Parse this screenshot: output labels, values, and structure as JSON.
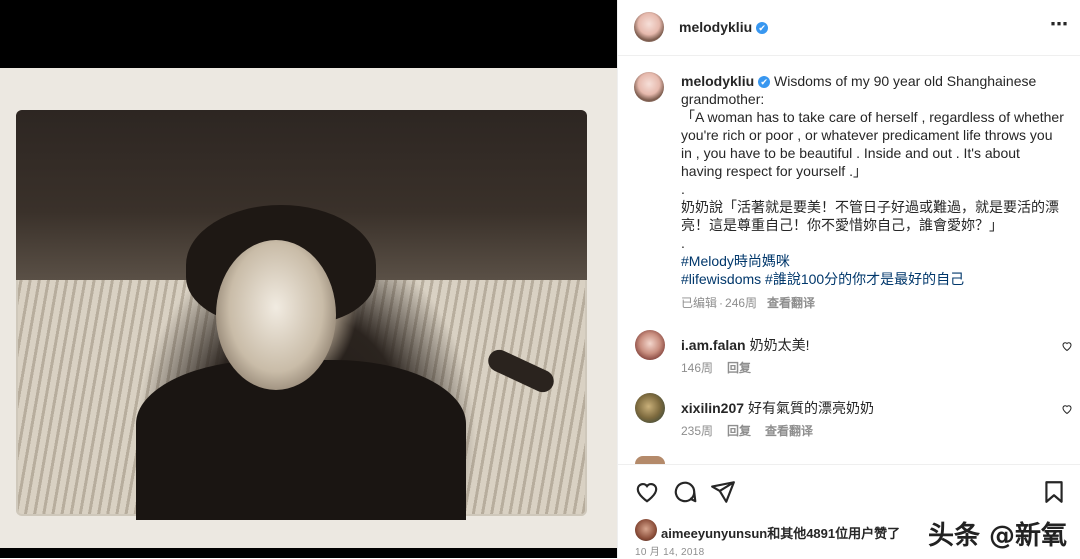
{
  "post": {
    "username": "melodykliu",
    "verified_badge": "✔",
    "more_icon": "⋯"
  },
  "caption": {
    "username": "melodykliu",
    "line1": "Wisdoms of my 90 year old Shanghainese grandmother:",
    "quote_en": "「A woman has to take care of herself , regardless of whether you're rich or poor , or whatever predicament life throws you in , you have to be beautiful . Inside and out . It's about having respect for yourself .」",
    "dot1": ".",
    "quote_zh": "奶奶說「活著就是要美！不管日子好過或難過，就是要活的漂亮！這是尊重自己！你不愛惜妳自己，誰會愛妳？」",
    "dot2": ".",
    "tag1": "#Melody時尚媽咪",
    "tag2": "#lifewisdoms",
    "tag3": "#誰說100分的你才是最好的自己",
    "meta_edited": "已编辑",
    "meta_dot": "·",
    "meta_age": "246周",
    "meta_translate": "查看翻译"
  },
  "comments": [
    {
      "username": "i.am.falan",
      "text": "奶奶太美!",
      "age": "146周",
      "reply": "回复",
      "translate": ""
    },
    {
      "username": "xixilin207",
      "text": "好有氣質的漂亮奶奶",
      "age": "235周",
      "reply": "回复",
      "translate": "查看翻译"
    }
  ],
  "actions": {
    "liked_user": "aimeeyunyunsun",
    "liked_rest": "和其他4891位用户赞了",
    "date": "10 月 14, 2018"
  },
  "watermark": "头条 @新氧",
  "colors": {
    "verified": "#3897f0",
    "hashtag": "#00376b",
    "muted": "#8e8e8e"
  }
}
